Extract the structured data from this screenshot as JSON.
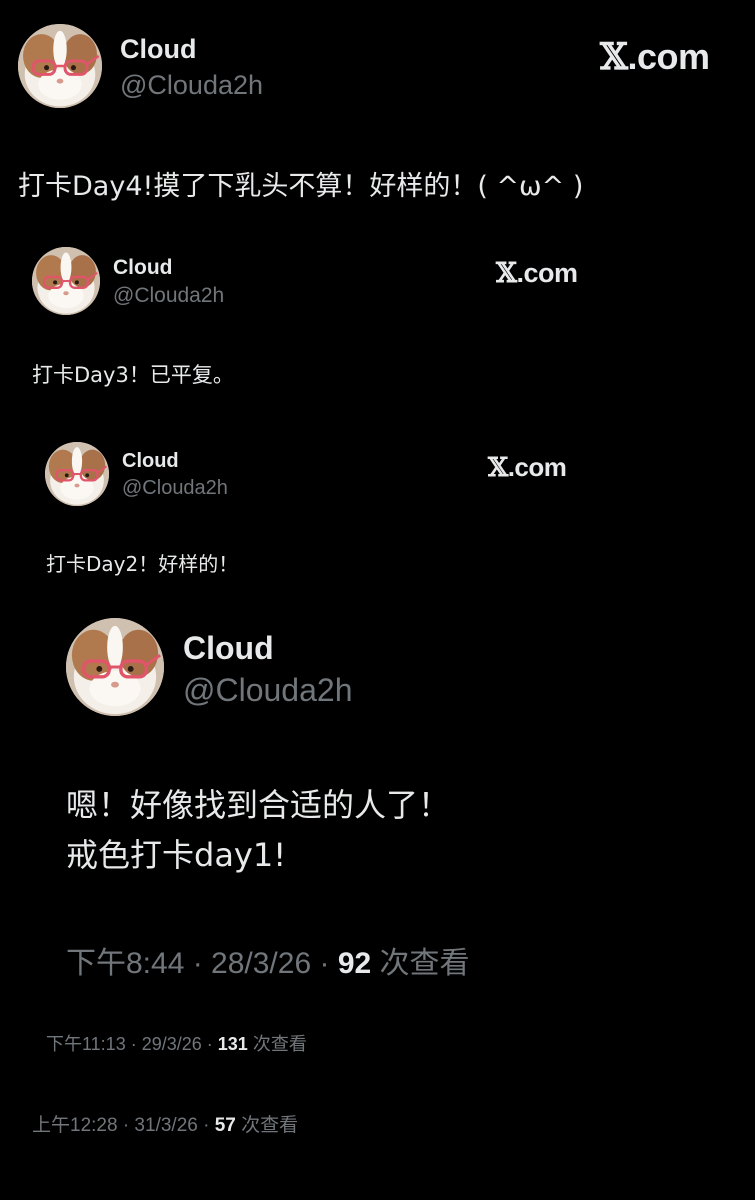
{
  "tweet_day4": {
    "name": "Cloud",
    "handle": "@Clouda2h",
    "brand_x": "𝕏",
    "brand_domain": ".com",
    "text": "打卡Day4!摸了下乳头不算！好样的！( ^ω^ )"
  },
  "tweet_day3": {
    "name": "Cloud",
    "handle": "@Clouda2h",
    "brand_x": "𝕏",
    "brand_domain": ".com",
    "text": "打卡Day3！已平复。"
  },
  "tweet_day2": {
    "name": "Cloud",
    "handle": "@Clouda2h",
    "brand_x": "𝕏",
    "brand_domain": ".com",
    "text": "打卡Day2！好样的！"
  },
  "tweet_day1": {
    "name": "Cloud",
    "handle": "@Clouda2h",
    "text_line1": "嗯！好像找到合适的人了！",
    "text_line2": "戒色打卡day1!",
    "meta_time": "下午8:44 · 28/3/26 · ",
    "meta_views": "92",
    "meta_suffix": " 次查看"
  },
  "meta_day2": {
    "time": "下午11:13 · 29/3/26 · ",
    "views": "131",
    "suffix": " 次查看"
  },
  "meta_day3": {
    "time": "上午12:28 · 31/3/26 · ",
    "views": "57",
    "suffix": " 次查看"
  },
  "colors": {
    "background": "#000000",
    "primary_text": "#e7e9ea",
    "secondary_text": "#71767b"
  },
  "icons": {
    "avatar": "guinea-pig-with-glasses",
    "brand": "x-logo"
  }
}
